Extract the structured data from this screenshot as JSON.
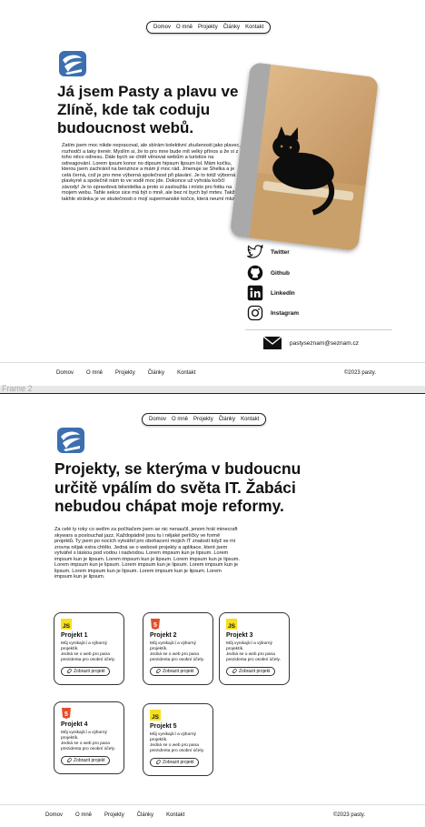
{
  "nav": {
    "items": [
      "Domov",
      "O mně",
      "Projekty",
      "Články",
      "Kontakt"
    ]
  },
  "about": {
    "title_line1": "Já jsem Pasty a plavu ve",
    "title_line2": "Zlíně, kde tak coduju",
    "title_line3": "budoucnost webů.",
    "paragraph": "Zatím jsem moc nikde nepracoval, ale sbírám kolektivní zkušenosti jako plavec, rozhodčí a taky trenér. Myslím si, že to pro mne bude mít velký přínos a že si z toho něco odnesu. Dále bych se chtěl věnovat webům a turistice na odreagování. Lorem ipsum konor no dipsum hipsum lipsum lol. Mám kočku, kterou jsem zachránil na benzince a mám jí moc rád. Jmenuje se Shelka a je celá černá, což je pro mne výborná společnost při plavání. Je to totiž výborná plavkyně a společně nám to ve vodě moc jde. Dokonce už vyhrála kočičí závody! Je to opravdová běsnitelka a proto si zasloužila i místo pro fotku na mojem webu. Tahle sekce sice má být o mně, ale bez ní bych byl mrtev. Takže takhle stránka je ve skutečnosti o mojí supermanské kočce, která neumí mluvit."
  },
  "socials": [
    {
      "label": "Twitter",
      "icon": "twitter-icon"
    },
    {
      "label": "Github",
      "icon": "github-icon"
    },
    {
      "label": "LinkedIn",
      "icon": "linkedin-icon"
    },
    {
      "label": "Instagram",
      "icon": "instagram-icon"
    }
  ],
  "email": "pastyseznam@seznam.cz",
  "frame_label": "Frame 2",
  "projects": {
    "title_line1": "Projekty, se kterýma v budoucnu",
    "title_line2": "určitě vpálím do světa IT. Žabáci",
    "title_line3": "nebudou chápat moje reformy.",
    "paragraph": "Za celé ty roky co sedím za počítačem jsem se nic nenaučil, jenom hrát minecraft skywars a poslouchat jazz. Každopádně jsou tu i nějaké perličky ve formě projektů. Ty jsem po nocích vytvářel pro obohacení mojich IT znalostí když se mi zrovna nějak extra chtělo. Jedná se o webové projekty a aplikace, které jsem vytvářel s láskou pod vodou i nadvodou. Lorem impsum kun je lipsum. Lorem impsum kun je lipsum. Lorem impsum kun je lipsum. Lorem impsum kun je lipsum. Lorem impsum kun je lipsum. Lorem impsum kun je lipsum. Lorem impsum kun je lipsum. Lorem impsum kun je lipsum. Lorem impsum kun je lipsum. Lorem impsum kun je lipsum.",
    "cards": [
      {
        "badge": "JS",
        "title": "Projekt 1",
        "line1": "Můj vynikající a výborný projektík.",
        "line2": "Jedná se o web pro pana prezidenta pro osobní účely.",
        "button": "Zobrazit projekt"
      },
      {
        "badge": "HTML5",
        "title": "Projekt 2",
        "line1": "Můj vynikající a výborný projektík.",
        "line2": "Jedná se o web pro pana prezidenta pro osobní účely.",
        "button": "Zobrazit projekt"
      },
      {
        "badge": "JS",
        "title": "Projekt 3",
        "line1": "Můj vynikající a výborný projektík.",
        "line2": "Jedná se o web pro pana prezidenta pro osobní účely.",
        "button": "Zobrazit projekt"
      },
      {
        "badge": "HTML5",
        "title": "Projekt 4",
        "line1": "Můj vynikající a výborný projektík.",
        "line2": "Jedná se o web pro pana prezidenta pro osobní účely.",
        "button": "Zobrazit projekt"
      },
      {
        "badge": "JS",
        "title": "Projekt 5",
        "line1": "Můj vynikající a výborný projektík.",
        "line2": "Jedná se o web pro pana prezidenta pro osobní účely.",
        "button": "Zobrazit projekt"
      }
    ]
  },
  "footer": {
    "links": [
      "Domov",
      "O mně",
      "Projekty",
      "Články",
      "Kontakt"
    ],
    "copyright": "©2023 pasty."
  },
  "colors": {
    "js_badge": "#f7df1e",
    "html_badge": "#e44d26",
    "logo_blue": "#3b6fb0",
    "wall": "#d2a87a"
  }
}
